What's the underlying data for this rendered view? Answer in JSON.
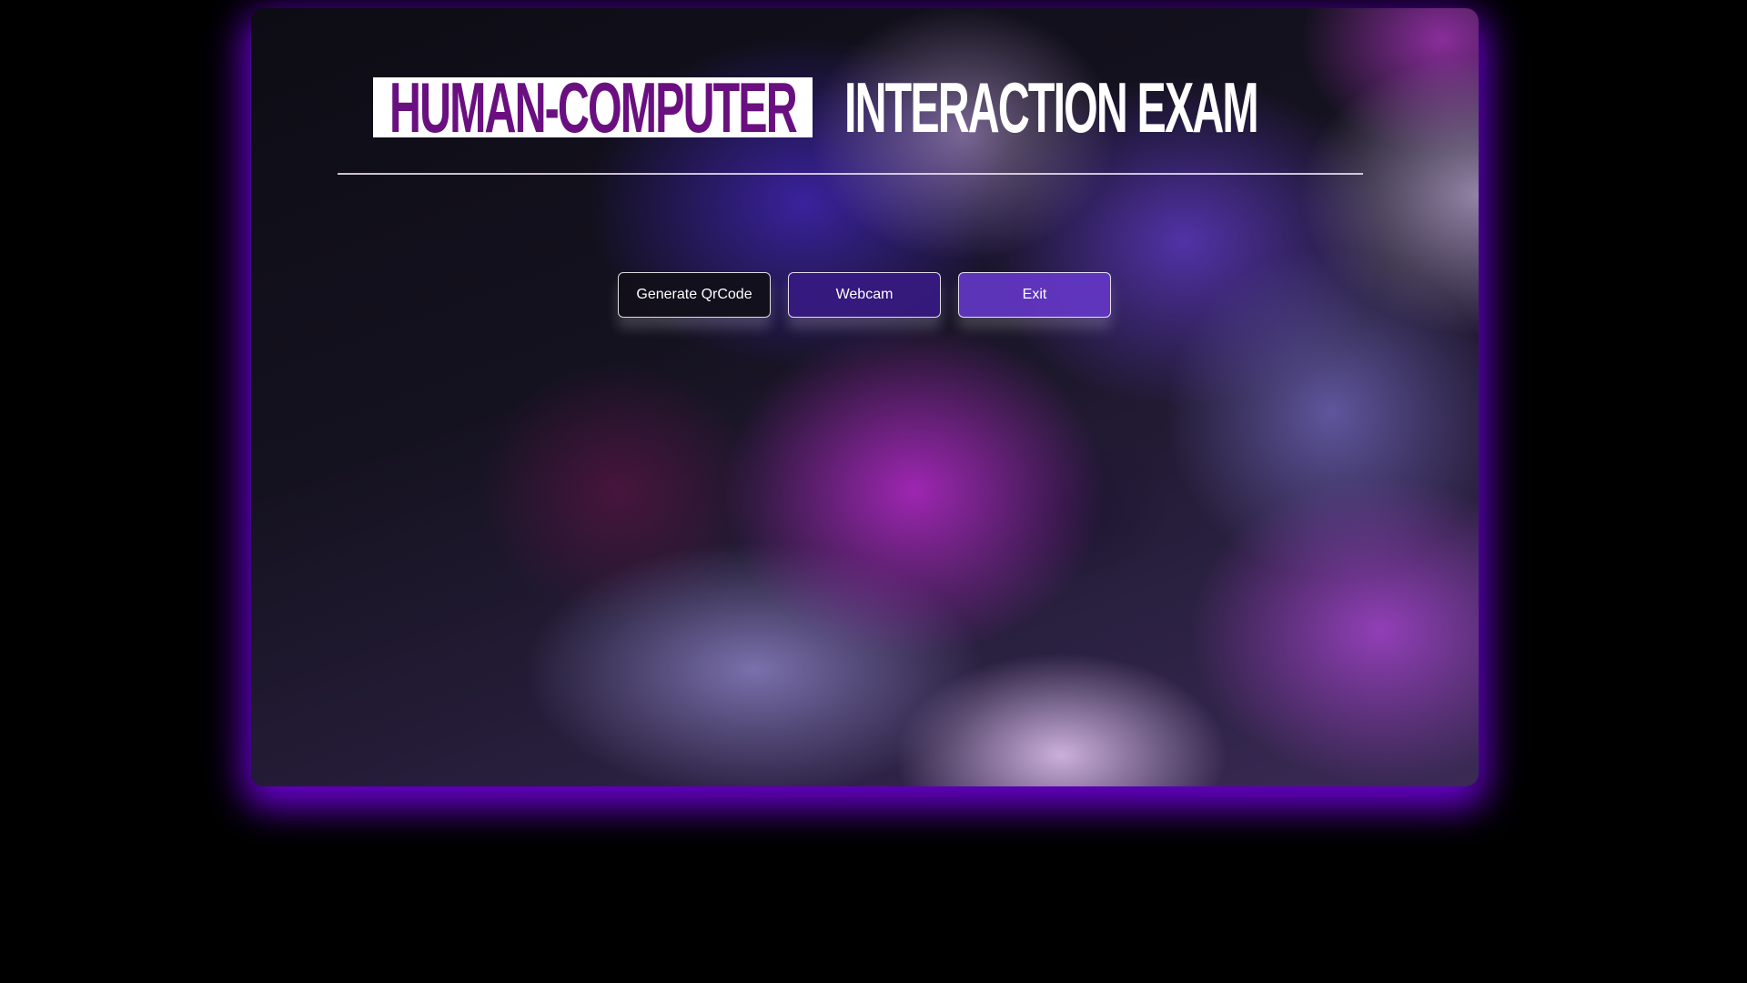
{
  "header": {
    "title_highlight": "HUMAN-COMPUTER",
    "title_rest": "INTERACTION EXAM"
  },
  "actions": {
    "generate_qrcode": "Generate QrCode",
    "webcam": "Webcam",
    "exit": "Exit"
  },
  "colors": {
    "page_background": "#000000",
    "title_highlight_text": "#6a0f80",
    "title_highlight_box": "#ffffff",
    "glow": "#7600e6"
  }
}
